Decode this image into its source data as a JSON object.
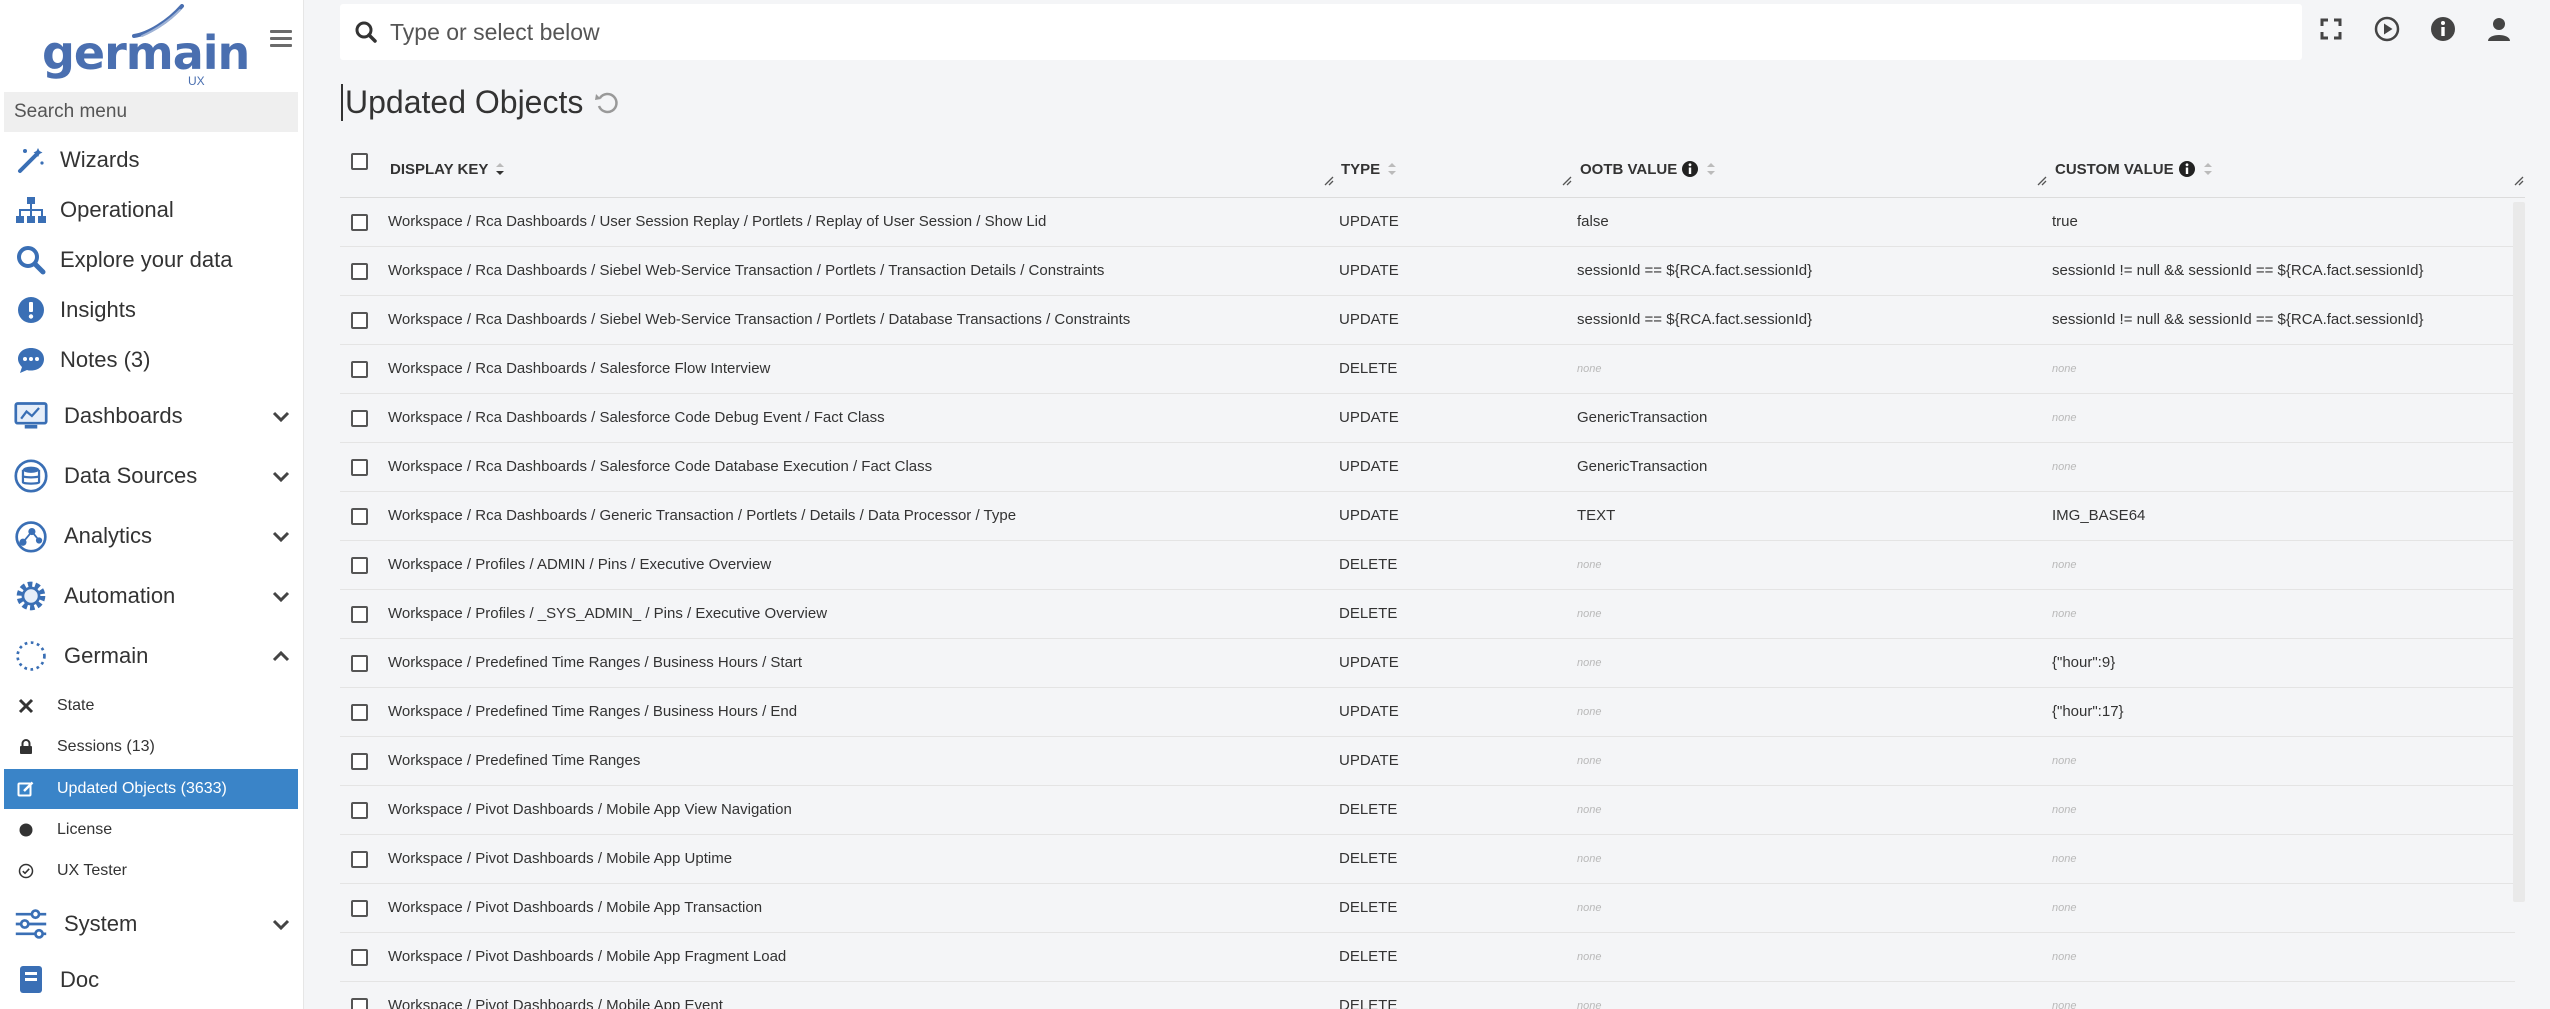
{
  "logo": {
    "word": "germain",
    "suffix": "UX"
  },
  "sidebar": {
    "search_placeholder": "Search menu",
    "top_items": [
      {
        "label": "Wizards",
        "icon": "wand-icon"
      },
      {
        "label": "Operational",
        "icon": "sitemap-icon"
      },
      {
        "label": "Explore your data",
        "icon": "search-icon"
      },
      {
        "label": "Insights",
        "icon": "exclamation-icon"
      },
      {
        "label": "Notes (3)",
        "icon": "comment-icon"
      }
    ],
    "groups": [
      {
        "label": "Dashboards",
        "icon": "monitor-icon",
        "expanded": false
      },
      {
        "label": "Data Sources",
        "icon": "database-icon",
        "expanded": false
      },
      {
        "label": "Analytics",
        "icon": "analytics-icon",
        "expanded": false
      },
      {
        "label": "Automation",
        "icon": "cog-icon",
        "expanded": false
      },
      {
        "label": "Germain",
        "icon": "spinner-icon",
        "expanded": true
      }
    ],
    "germain_sub": [
      {
        "label": "State",
        "icon": "tools-icon",
        "active": false
      },
      {
        "label": "Sessions (13)",
        "icon": "lock-icon",
        "active": false
      },
      {
        "label": "Updated Objects (3633)",
        "icon": "edit-icon",
        "active": true
      },
      {
        "label": "License",
        "icon": "badge-icon",
        "active": false
      },
      {
        "label": "UX Tester",
        "icon": "check-circle-icon",
        "active": false
      }
    ],
    "bottom_items": [
      {
        "label": "System",
        "icon": "sliders-icon"
      },
      {
        "label": "Doc",
        "icon": "book-icon"
      }
    ]
  },
  "topbar": {
    "search_placeholder": "Type or select below"
  },
  "page": {
    "title": "Updated Objects"
  },
  "grid": {
    "columns": [
      "Display Key",
      "Type",
      "OOTB Value",
      "Custom Value"
    ],
    "rows": [
      {
        "key": "Workspace / Rca Dashboards / User Session Replay / Portlets / Replay of User Session / Show Lid",
        "type": "UPDATE",
        "ootb": "false",
        "custom": "true"
      },
      {
        "key": "Workspace / Rca Dashboards / Siebel Web-Service Transaction / Portlets / Transaction Details / Constraints",
        "type": "UPDATE",
        "ootb": "sessionId == ${RCA.fact.sessionId}",
        "custom": "sessionId != null && sessionId == ${RCA.fact.sessionId}"
      },
      {
        "key": "Workspace / Rca Dashboards / Siebel Web-Service Transaction / Portlets / Database Transactions / Constraints",
        "type": "UPDATE",
        "ootb": "sessionId == ${RCA.fact.sessionId}",
        "custom": "sessionId != null && sessionId == ${RCA.fact.sessionId}"
      },
      {
        "key": "Workspace / Rca Dashboards / Salesforce Flow Interview",
        "type": "DELETE",
        "ootb": "none",
        "custom": "none"
      },
      {
        "key": "Workspace / Rca Dashboards / Salesforce Code Debug Event / Fact Class",
        "type": "UPDATE",
        "ootb": "GenericTransaction",
        "custom": "none"
      },
      {
        "key": "Workspace / Rca Dashboards / Salesforce Code Database Execution / Fact Class",
        "type": "UPDATE",
        "ootb": "GenericTransaction",
        "custom": "none"
      },
      {
        "key": "Workspace / Rca Dashboards / Generic Transaction / Portlets / Details / Data Processor / Type",
        "type": "UPDATE",
        "ootb": "TEXT",
        "custom": "IMG_BASE64"
      },
      {
        "key": "Workspace / Profiles / ADMIN / Pins / Executive Overview",
        "type": "DELETE",
        "ootb": "none",
        "custom": "none"
      },
      {
        "key": "Workspace / Profiles / _SYS_ADMIN_ / Pins / Executive Overview",
        "type": "DELETE",
        "ootb": "none",
        "custom": "none"
      },
      {
        "key": "Workspace / Predefined Time Ranges / Business Hours / Start",
        "type": "UPDATE",
        "ootb": "none",
        "custom": "{\"hour\":9}"
      },
      {
        "key": "Workspace / Predefined Time Ranges / Business Hours / End",
        "type": "UPDATE",
        "ootb": "none",
        "custom": "{\"hour\":17}"
      },
      {
        "key": "Workspace / Predefined Time Ranges",
        "type": "UPDATE",
        "ootb": "none",
        "custom": "none"
      },
      {
        "key": "Workspace / Pivot Dashboards / Mobile App View Navigation",
        "type": "DELETE",
        "ootb": "none",
        "custom": "none"
      },
      {
        "key": "Workspace / Pivot Dashboards / Mobile App Uptime",
        "type": "DELETE",
        "ootb": "none",
        "custom": "none"
      },
      {
        "key": "Workspace / Pivot Dashboards / Mobile App Transaction",
        "type": "DELETE",
        "ootb": "none",
        "custom": "none"
      },
      {
        "key": "Workspace / Pivot Dashboards / Mobile App Fragment Load",
        "type": "DELETE",
        "ootb": "none",
        "custom": "none"
      },
      {
        "key": "Workspace / Pivot Dashboards / Mobile App Event",
        "type": "DELETE",
        "ootb": "none",
        "custom": "none"
      }
    ]
  },
  "colors": {
    "accent": "#3a84c8",
    "brand": "#4a6fb0"
  }
}
